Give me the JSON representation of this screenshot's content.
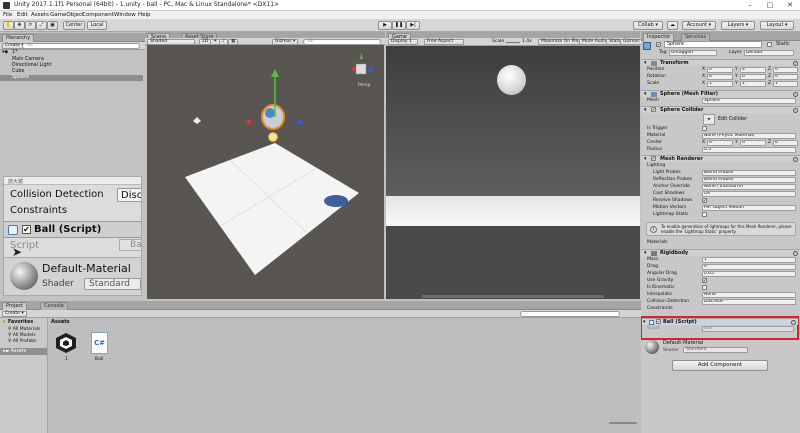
{
  "window": {
    "title": "Unity 2017.1.1f1 Personal (64bit) - 1.unity - ball - PC, Mac & Linux Standalone* <DX11>"
  },
  "menu": [
    "File",
    "Edit",
    "Assets",
    "GameObject",
    "Component",
    "Window",
    "Help"
  ],
  "toolbar": {
    "pivot_center": "Center",
    "pivot_local": "Local",
    "collab": "Collab",
    "account": "Account",
    "layers": "Layers",
    "layout": "Layout"
  },
  "hierarchy": {
    "tab": "Hierarchy",
    "create": "Create",
    "search_placeholder": "All",
    "scene_name": "1*",
    "items": [
      "Main Camera",
      "Directional Light",
      "Cube",
      "Sphere"
    ]
  },
  "scene_view": {
    "tab_scene": "Scene",
    "tab_asset_store": "Asset Store",
    "shading": "Shaded",
    "mode_2d": "2D",
    "gizmos": "Gizmos",
    "search_placeholder": "All",
    "persp_label": "Persp"
  },
  "game_view": {
    "tab": "Game",
    "display": "Display 1",
    "aspect": "Free Aspect",
    "scale_label": "Scale",
    "scale_value": "1.4x",
    "maximize": "Maximize On Play",
    "mute": "Mute Audio",
    "stats": "Stats",
    "gizmos": "Gizmos"
  },
  "zoom_overlay": {
    "header": "放大镜",
    "row_collision": "Collision Detection",
    "row_collision_val": "Disc",
    "row_constraints": "Constraints",
    "component": "Ball (Script)",
    "script_label": "Script",
    "script_val": "Ba",
    "material": "Default-Material",
    "shader_label": "Shader",
    "shader_val": "Standard"
  },
  "inspector": {
    "tab_inspector": "Inspector",
    "tab_services": "Services",
    "object_name": "Sphere",
    "static_label": "Static",
    "tag_label": "Tag",
    "tag_value": "Untagged",
    "layer_label": "Layer",
    "layer_value": "Default",
    "transform": {
      "title": "Transform",
      "position_label": "Position",
      "rotation_label": "Rotation",
      "scale_label": "Scale",
      "position": [
        "0",
        "4",
        "0"
      ],
      "rotation": [
        "0",
        "0",
        "0"
      ],
      "scale": [
        "1",
        "1",
        "1"
      ]
    },
    "mesh_filter": {
      "title": "Sphere (Mesh Filter)",
      "mesh_label": "Mesh",
      "mesh_value": "Sphere"
    },
    "sphere_collider": {
      "title": "Sphere Collider",
      "edit_collider": "Edit Collider",
      "is_trigger": "Is Trigger",
      "material_label": "Material",
      "material_value": "None (Physic Material)",
      "center_label": "Center",
      "center": [
        "0",
        "0",
        "0"
      ],
      "radius_label": "Radius",
      "radius_value": "0.5"
    },
    "mesh_renderer": {
      "title": "Mesh Renderer",
      "lighting": "Lighting",
      "light_probes_label": "Light Probes",
      "light_probes_value": "Blend Probes",
      "reflection_probes_label": "Reflection Probes",
      "reflection_probes_value": "Blend Probes",
      "anchor_override_label": "Anchor Override",
      "anchor_override_value": "None (Transform)",
      "cast_shadows_label": "Cast Shadows",
      "cast_shadows_value": "On",
      "receive_shadows_label": "Receive Shadows",
      "motion_vectors_label": "Motion Vectors",
      "motion_vectors_value": "Per Object Motion",
      "lightmap_static_label": "Lightmap Static",
      "info": "To enable generation of lightmaps for this Mesh Renderer, please enable the 'Lightmap Static' property.",
      "materials": "Materials"
    },
    "rigidbody": {
      "title": "Rigidbody",
      "mass_label": "Mass",
      "mass_value": "1",
      "drag_label": "Drag",
      "drag_value": "0",
      "angular_drag_label": "Angular Drag",
      "angular_drag_value": "0.05",
      "use_gravity_label": "Use Gravity",
      "is_kinematic_label": "Is Kinematic",
      "interpolate_label": "Interpolate",
      "interpolate_value": "None",
      "collision_label": "Collision Detection",
      "collision_value": "Discrete",
      "constraints_label": "Constraints"
    },
    "ball_script": {
      "title": "Ball (Script)",
      "script_label": "Script",
      "script_value": "Ball"
    },
    "material": {
      "name": "Default-Material",
      "shader_label": "Shader",
      "shader_value": "Standard"
    },
    "add_component": "Add Component"
  },
  "project": {
    "tab_project": "Project",
    "tab_console": "Console",
    "create": "Create",
    "favorites": "Favorites",
    "fav_items": [
      "All Materials",
      "All Models",
      "All Prefabs"
    ],
    "assets_root": "Assets",
    "breadcrumb": "Assets",
    "files": [
      {
        "name": "1",
        "icon": "unity-scene-icon"
      },
      {
        "name": "Ball",
        "icon": "csharp-script-icon",
        "glyph": "C#"
      }
    ]
  },
  "colors": {
    "highlight_red": "#d8232a",
    "unity_gray": "#c2c2c2",
    "scene_bg": "#595651"
  }
}
